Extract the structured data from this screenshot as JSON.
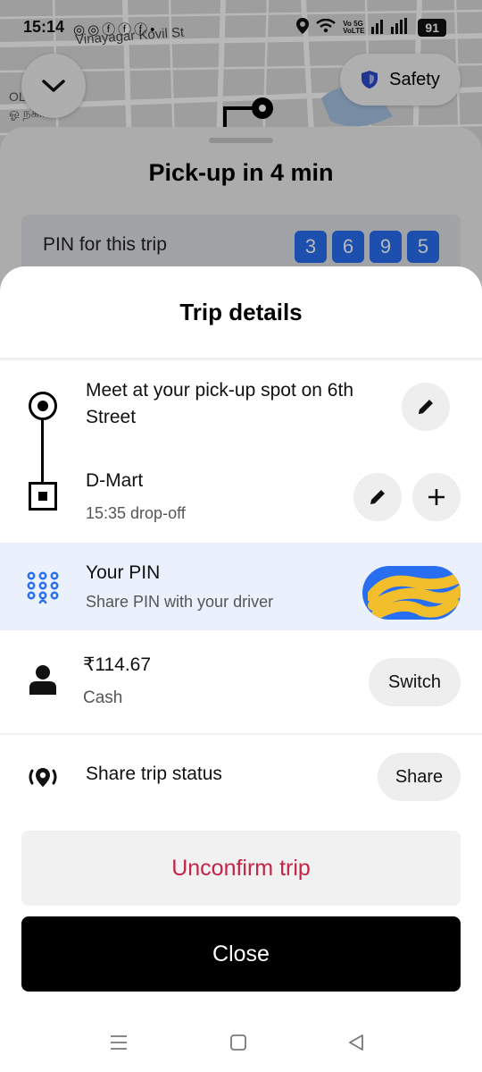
{
  "status_bar": {
    "time": "15:14",
    "network_label_top": "Vo 5G",
    "network_label_bottom": "VoLTE",
    "battery": "91"
  },
  "map": {
    "street_label": "Vinayagar Kovil St",
    "area_label_en": "OL      GAR",
    "area_label_ta": "ஓ      நகர்"
  },
  "safety": {
    "label": "Safety"
  },
  "background_sheet": {
    "title": "Pick-up in 4 min",
    "pin_label": "PIN for this trip",
    "pin_digits": [
      "3",
      "6",
      "9",
      "5"
    ]
  },
  "trip_details": {
    "title": "Trip details",
    "pickup": {
      "text": "Meet at your pick-up spot on 6th Street"
    },
    "dropoff": {
      "title": "D-Mart",
      "subtitle": "15:35 drop-off"
    },
    "pin": {
      "title": "Your PIN",
      "subtitle": "Share PIN with your driver"
    },
    "payment": {
      "amount": "₹114.67",
      "method": "Cash",
      "button": "Switch"
    },
    "share": {
      "title": "Share trip status",
      "button": "Share"
    },
    "unconfirm_label": "Unconfirm trip",
    "close_label": "Close"
  },
  "colors": {
    "accent_blue": "#276ef1",
    "unconfirm_red": "#c42447",
    "pin_row_bg": "#eaf1fd"
  }
}
